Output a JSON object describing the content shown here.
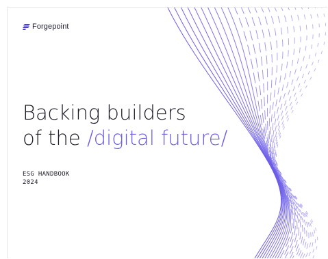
{
  "brand": {
    "name": "Forgepoint"
  },
  "headline": {
    "line1": "Backing builders",
    "line2_prefix": "of the ",
    "line2_accent": "/digital future/"
  },
  "document": {
    "label": "ESG HANDBOOK",
    "year": "2024"
  },
  "colors": {
    "accent": "#6b5ce7",
    "text": "#1b1b26",
    "background": "#ffffff"
  }
}
